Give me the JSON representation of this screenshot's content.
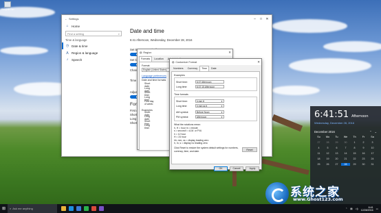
{
  "desktop": {
    "icon_label": "Recycle Bin"
  },
  "settings": {
    "title": "Settings",
    "sidebar": {
      "home": "Home",
      "search_placeholder": "Find a setting",
      "section": "Time & language",
      "items": [
        {
          "label": "Date & time",
          "icon": "clock-icon",
          "active": true
        },
        {
          "label": "Region & language",
          "icon": "globe-icon",
          "active": false
        },
        {
          "label": "Speech",
          "icon": "microphone-icon",
          "active": false
        }
      ]
    },
    "main": {
      "title": "Date and time",
      "current": "6:41 Afternoon, Wednesday, December 28, 2016",
      "set_time_auto": "Set time automatically",
      "set_time_zone_trunc": "Set ti",
      "change_trunc": "Chang",
      "time_trunc": "Time",
      "adjust_trunc": "Adjust",
      "formats_heading_trunc": "Form",
      "first_trunc": "First d",
      "short_trunc": "Short",
      "long_trunc": "Long d",
      "short2_trunc": "Short"
    }
  },
  "region": {
    "title": "Region",
    "tabs": [
      "Formats",
      "Location",
      "Administrative"
    ],
    "format_label": "Format:",
    "format_value": "English (United States)",
    "link": "Language preferences",
    "date_time_formats": "Date and time formats",
    "rows": [
      "Short date:",
      "Long date:",
      "Short time:",
      "Long time:",
      "First day of week:"
    ],
    "examples_label": "Examples",
    "example_rows": [
      "Short date:",
      "Long date:",
      "Short time:",
      "Long time:"
    ]
  },
  "customize": {
    "title": "Customize Format",
    "tabs": [
      "Numbers",
      "Currency",
      "Time",
      "Date"
    ],
    "active_tab": "Time",
    "examples_label": "Examples",
    "examples": [
      {
        "label": "Short time:",
        "value": "6:07 Afternoon"
      },
      {
        "label": "Long time:",
        "value": "6:07:15 Afternoon"
      }
    ],
    "formats_label": "Time formats",
    "formats": [
      {
        "label": "Short time:",
        "value": "h:mm tt"
      },
      {
        "label": "Long time:",
        "value": "h:mm:ss tt"
      },
      {
        "label": "AM symbol:",
        "value": "Before Noon"
      },
      {
        "label": "PM symbol:",
        "value": "Afternoon"
      }
    ],
    "notation_heading": "What the notations mean:",
    "notation_lines": [
      "h, H = hour   m = minute",
      "s = second   t = A.M. or P.M.",
      "h = 12 hour",
      "H = 24 hour",
      "hh, mm, ss = display leading zero",
      "h, m, s = display no leading zero"
    ],
    "footer_text": "Click Reset to restore the system default settings for numbers, currency, time, and date.",
    "reset_label": "Reset",
    "ok_label": "OK",
    "cancel_label": "Cancel",
    "apply_label": "Apply"
  },
  "clock": {
    "time": "6:41:51",
    "ampm": "Afternoon",
    "date": "Wednesday, December 28, 2016",
    "month": "December 2016",
    "weekdays": [
      "Su",
      "Mo",
      "Tu",
      "We",
      "Th",
      "Fr",
      "Sa"
    ],
    "days": [
      {
        "d": "27",
        "m": true
      },
      {
        "d": "28",
        "m": true
      },
      {
        "d": "29",
        "m": true
      },
      {
        "d": "30",
        "m": true
      },
      {
        "d": "1",
        "m": false
      },
      {
        "d": "2",
        "m": false
      },
      {
        "d": "3",
        "m": false
      },
      {
        "d": "4",
        "m": false
      },
      {
        "d": "5",
        "m": false
      },
      {
        "d": "6",
        "m": false
      },
      {
        "d": "7",
        "m": false
      },
      {
        "d": "8",
        "m": false
      },
      {
        "d": "9",
        "m": false
      },
      {
        "d": "10",
        "m": false
      },
      {
        "d": "11",
        "m": false
      },
      {
        "d": "12",
        "m": false
      },
      {
        "d": "13",
        "m": false
      },
      {
        "d": "14",
        "m": false
      },
      {
        "d": "15",
        "m": false
      },
      {
        "d": "16",
        "m": false
      },
      {
        "d": "17",
        "m": false
      },
      {
        "d": "18",
        "m": false
      },
      {
        "d": "19",
        "m": false
      },
      {
        "d": "20",
        "m": false
      },
      {
        "d": "21",
        "m": false
      },
      {
        "d": "22",
        "m": false
      },
      {
        "d": "23",
        "m": false
      },
      {
        "d": "24",
        "m": false
      },
      {
        "d": "25",
        "m": false
      },
      {
        "d": "26",
        "m": false
      },
      {
        "d": "27",
        "m": false
      },
      {
        "d": "28",
        "m": false,
        "today": true
      },
      {
        "d": "29",
        "m": false
      },
      {
        "d": "30",
        "m": false
      },
      {
        "d": "31",
        "m": false
      }
    ]
  },
  "taskbar": {
    "search_placeholder": "Ask me anything",
    "tray_time": "6:41",
    "tray_date": "12/28/2016",
    "app_colors": [
      "#e8b33a",
      "#1d8fe0",
      "#3c7bd6",
      "#2bb24c",
      "#d94b3b",
      "#7a52c7"
    ]
  },
  "watermark": {
    "text": "系统之家",
    "url": "www.Ghost123.com"
  }
}
